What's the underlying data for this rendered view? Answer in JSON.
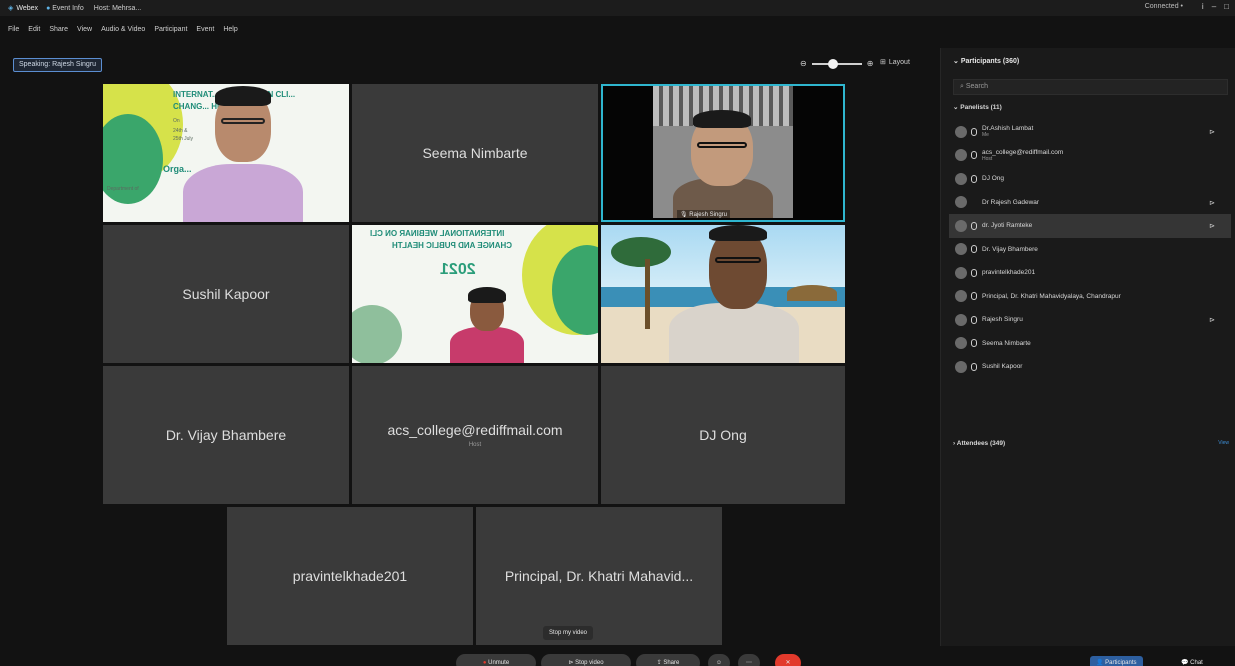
{
  "titlebar": {
    "app": "Webex",
    "event_info": "Event Info",
    "host": "Host: Mehrsa...",
    "connected": "Connected •"
  },
  "menu": [
    "File",
    "Edit",
    "Share",
    "View",
    "Audio & Video",
    "Participant",
    "Event",
    "Help"
  ],
  "speaking": "Speaking: Rajesh Singru",
  "layout_label": "Layout",
  "tiles": {
    "seema": "Seema Nimbarte",
    "sushil": "Sushil Kapoor",
    "vijay": "Dr. Vijay Bhambere",
    "acs": "acs_college@rediffmail.com",
    "acs_role": "Host",
    "djong": "DJ Ong",
    "pravin": "pravintelkhade201",
    "principal": "Principal, Dr. Khatri Mahavid...",
    "rajesh_caption": "Rajesh Singru"
  },
  "banner": {
    "line1": "INTERNAT... WEBINAR ON CLI...",
    "line2": "CHANG... HEALTH",
    "on": "On",
    "date1": "24th &",
    "date2": "25th July",
    "org": "Orga...",
    "dept": "Department of",
    "mirrored_line1": "INTERNATIONAL WEBINAR ON CLI",
    "mirrored_line2": "CHANGE AND PUBLIC HEALTH",
    "mirrored_year": "2021"
  },
  "panel": {
    "title": "Participants (360)",
    "search_placeholder": "Search",
    "panelists_header": "Panelists (11)",
    "attendees_header": "Attendees (349)",
    "view_all": "View",
    "panelists": [
      {
        "name": "Dr.Ashish Lambat",
        "role": "Me",
        "cam": true
      },
      {
        "name": "acs_college@rediffmail.com",
        "role": "Host",
        "cam": false
      },
      {
        "name": "DJ Ong",
        "role": "",
        "cam": false
      },
      {
        "name": "Dr Rajesh Gadewar",
        "role": "",
        "cam": true
      },
      {
        "name": "dr. Jyoti Ramteke",
        "role": "",
        "cam": true
      },
      {
        "name": "Dr. Vijay Bhambere",
        "role": "",
        "cam": false
      },
      {
        "name": "pravintelkhade201",
        "role": "",
        "cam": false
      },
      {
        "name": "Principal, Dr. Khatri Mahavidyalaya, Chandrapur",
        "role": "",
        "cam": false
      },
      {
        "name": "Rajesh Singru",
        "role": "",
        "cam": true
      },
      {
        "name": "Seema Nimbarte",
        "role": "",
        "cam": false
      },
      {
        "name": "Sushil Kapoor",
        "role": "",
        "cam": false
      }
    ]
  },
  "bottom": {
    "stop_my_video": "Stop my video",
    "unmute": "Unmute",
    "stop_video": "Stop video",
    "share": "Share",
    "participants": "Participants",
    "chat": "Chat"
  },
  "colors": {
    "accent": "#2fb6cf",
    "leave": "#e23a2c",
    "link": "#3d8ed6"
  }
}
